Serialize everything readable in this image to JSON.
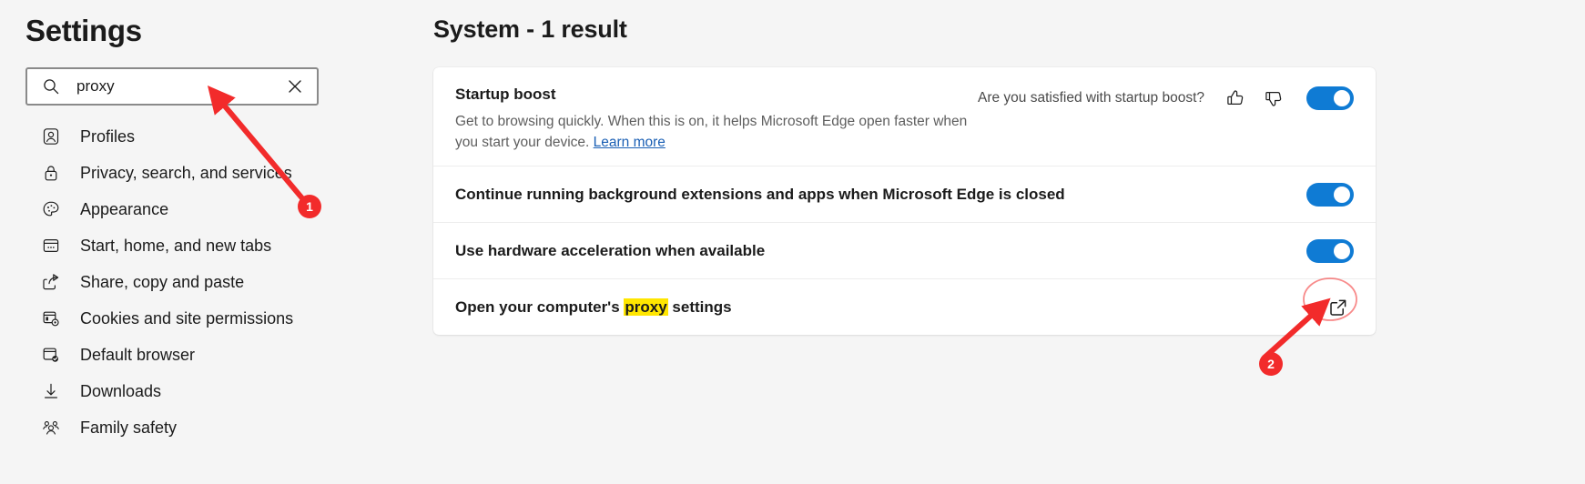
{
  "sidebar": {
    "title": "Settings",
    "search": {
      "value": "proxy",
      "placeholder": "Search settings",
      "icon": "search-icon",
      "clear_icon": "close-icon"
    },
    "items": [
      {
        "label": "Profiles",
        "icon": "profile-icon"
      },
      {
        "label": "Privacy, search, and services",
        "icon": "lock-icon"
      },
      {
        "label": "Appearance",
        "icon": "palette-icon"
      },
      {
        "label": "Start, home, and new tabs",
        "icon": "browser-window-icon"
      },
      {
        "label": "Share, copy and paste",
        "icon": "share-icon"
      },
      {
        "label": "Cookies and site permissions",
        "icon": "cookies-gear-icon"
      },
      {
        "label": "Default browser",
        "icon": "browser-check-icon"
      },
      {
        "label": "Downloads",
        "icon": "download-arrow-icon"
      },
      {
        "label": "Family safety",
        "icon": "people-icon"
      }
    ]
  },
  "main": {
    "heading": "System - 1 result",
    "rows": [
      {
        "title": "Startup boost",
        "description_part1": "Get to browsing quickly. When this is on, it helps Microsoft Edge open faster when you start your device. ",
        "link_label": "Learn more",
        "feedback_question": "Are you satisfied with startup boost?",
        "thumbs_up_icon": "thumbs-up-icon",
        "thumbs_down_icon": "thumbs-down-icon",
        "toggle_state": "on"
      },
      {
        "title": "Continue running background extensions and apps when Microsoft Edge is closed",
        "toggle_state": "on"
      },
      {
        "title": "Use hardware acceleration when available",
        "toggle_state": "on"
      },
      {
        "title_before": "Open your computer's ",
        "title_highlight": "proxy",
        "title_after": " settings",
        "action_icon": "external-link-icon"
      }
    ]
  },
  "annotations": {
    "badge_1": "1",
    "badge_2": "2",
    "color": "#f22b2b"
  },
  "colors": {
    "toggle_on": "#0f7bd4",
    "highlight": "#ffe600",
    "link": "#1a5fb4",
    "page_bg": "#f5f5f5",
    "card_bg": "#ffffff"
  }
}
